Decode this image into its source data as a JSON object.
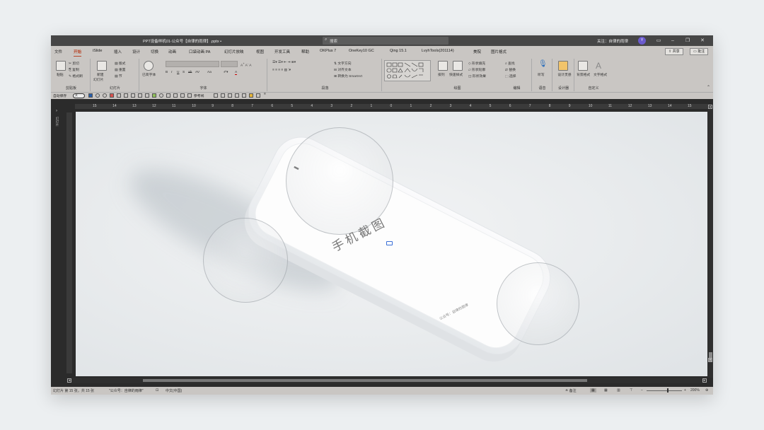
{
  "window": {
    "title": "PPT设备样机01-公众号【自律的雨律】.pptx  •",
    "search": "搜索",
    "follow": "关注：自律的雨律",
    "avatar": "Y"
  },
  "menu": {
    "tabs": [
      "文件",
      "开始",
      "iSlide",
      "插入",
      "设计",
      "切换",
      "动画",
      "口袋动画 PA",
      "幻灯片放映",
      "视图",
      "开发工具",
      "帮助",
      "OKPlus 7",
      "OneKey10 GC",
      "Qing 15.1",
      "LvyhTools(201114)",
      "美院",
      "图片格式"
    ],
    "active_index": 1,
    "share": "共享",
    "comment": "批注"
  },
  "ribbon": {
    "groups": [
      {
        "label": "剪贴板",
        "items": [
          "粘贴",
          "剪切",
          "复制",
          "格式刷"
        ]
      },
      {
        "label": "幻灯片",
        "items": [
          "新建",
          "幻灯片",
          "版式",
          "重置",
          "节"
        ]
      },
      {
        "label": "字体",
        "items": [
          "B",
          "I",
          "U",
          "S",
          "ab",
          "AV",
          "Aa",
          "A"
        ]
      },
      {
        "label": "段落",
        "items": [
          "文字方向",
          "对齐文本",
          "转换为 SmartArt"
        ]
      },
      {
        "label": "绘图",
        "items": [
          "排列",
          "快速样式",
          "形状填充",
          "形状轮廓",
          "形状效果"
        ]
      },
      {
        "label": "编辑",
        "items": [
          "查找",
          "替换",
          "选择"
        ]
      },
      {
        "label": "语音",
        "items": [
          "听写"
        ]
      },
      {
        "label": "设计器",
        "items": [
          "设计灵感"
        ]
      },
      {
        "label": "自定义",
        "items": [
          "背景格式",
          "文字格式"
        ]
      }
    ],
    "special": "已简字体"
  },
  "qat": {
    "autosave": "自动保存",
    "toggle": "关",
    "items": [
      "参考线"
    ]
  },
  "ruler": {
    "ticks": [
      "16",
      "15",
      "14",
      "13",
      "12",
      "11",
      "10",
      "9",
      "8",
      "7",
      "6",
      "5",
      "4",
      "3",
      "2",
      "1",
      "0",
      "1",
      "2",
      "3",
      "4",
      "5",
      "6",
      "7",
      "8",
      "9",
      "10",
      "11",
      "12",
      "13",
      "14",
      "15",
      "16"
    ]
  },
  "slide": {
    "phone_title": "手机截图",
    "phone_sub": "公众号：自律的雨律",
    "side_label": "幻灯片"
  },
  "status": {
    "slide_info": "幻灯片 第 15 张，共 15 张",
    "theme": "\"公众号：自律的雨律\"",
    "lang": "中文(中国)",
    "notes": "备注",
    "zoom": "200%"
  },
  "colors": {
    "accent": "#b7472a",
    "window_bg": "#2b2b2b",
    "ribbon": "#c9c6c3",
    "avatar": "#6a5acd"
  }
}
